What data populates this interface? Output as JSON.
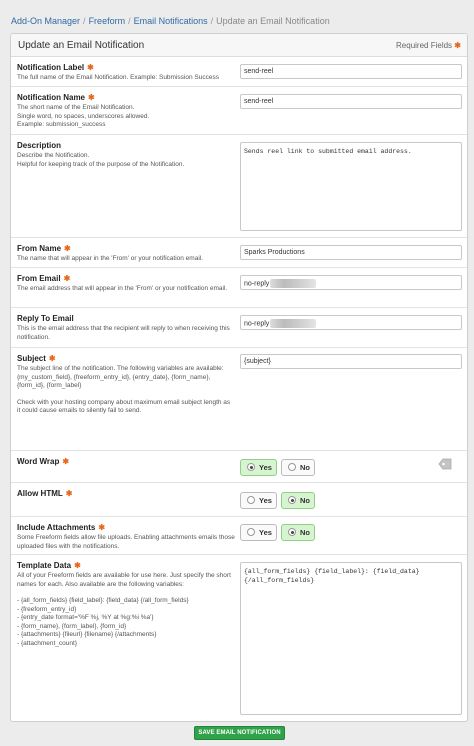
{
  "breadcrumb": {
    "items": [
      "Add-On Manager",
      "Freeform",
      "Email Notifications"
    ],
    "current": "Update an Email Notification"
  },
  "panel": {
    "title": "Update an Email Notification",
    "required_note": "Required Fields"
  },
  "fields": {
    "notification_label": {
      "label": "Notification Label",
      "description": [
        "The full name of the Email Notification. Example: Submission Success"
      ],
      "value": "send-reel"
    },
    "notification_name": {
      "label": "Notification Name",
      "description": [
        "The short name of the Email Notification.",
        "Single word, no spaces, underscores allowed.",
        "Example: submission_success"
      ],
      "value": "send-reel"
    },
    "description": {
      "label": "Description",
      "description": [
        "Describe the Notification.",
        "Helpful for keeping track of the purpose of the Notification."
      ],
      "value": "Sends reel link to submitted email address."
    },
    "from_name": {
      "label": "From Name",
      "description": [
        "The name that will appear in the 'From' or your notification email."
      ],
      "value": "Sparks Productions"
    },
    "from_email": {
      "label": "From Email",
      "description": [
        "The email address that will appear in the 'From' or your notification email."
      ],
      "value_prefix": "no-reply"
    },
    "reply_to_email": {
      "label": "Reply To Email",
      "description": [
        "This is the email address that the recipient will reply to when receiving this notification."
      ],
      "value_prefix": "no-reply"
    },
    "subject": {
      "label": "Subject",
      "description": [
        "The subject line of the notification. The following variables are available: {my_custom_field}, {freeform_entry_id}, {entry_date}, {form_name}, {form_id}, {form_label}",
        "",
        "Check with your hosting company about maximum email subject length as it could cause emails to silently fail to send."
      ],
      "value": "{subject}"
    },
    "word_wrap": {
      "label": "Word Wrap",
      "yes": "Yes",
      "no": "No",
      "selected": "yes"
    },
    "allow_html": {
      "label": "Allow HTML",
      "yes": "Yes",
      "no": "No",
      "selected": "no"
    },
    "include_attachments": {
      "label": "Include Attachments",
      "description": [
        "Some Freeform fields allow file uploads. Enabling attachments emails those uploaded files with the notifications."
      ],
      "yes": "Yes",
      "no": "No",
      "selected": "no"
    },
    "template_data": {
      "label": "Template Data",
      "description": [
        "All of your Freeform fields are available for use here. Just specify the short names for each. Also available are the following variables:",
        "",
        "- {all_form_fields} {field_label}: {field_data} {/all_form_fields}",
        "- {freeform_entry_id}",
        "- {entry_date format='%F %j, %Y at %g:%i %a'}",
        "- {form_name}, {form_label}, {form_id}",
        "- {attachments} {fileurl} {filename} {/attachments}",
        "- {attachment_count}"
      ],
      "value_lines": [
        "{all_form_fields} {field_label}: {field_data}",
        "{/all_form_fields}"
      ]
    }
  },
  "save_button": "SAVE EMAIL NOTIFICATION",
  "colors": {
    "accent_green": "#2fa24a",
    "required_star": "#e8661a",
    "link": "#2f6ba3",
    "toggle_on": "#d7f4d1"
  }
}
